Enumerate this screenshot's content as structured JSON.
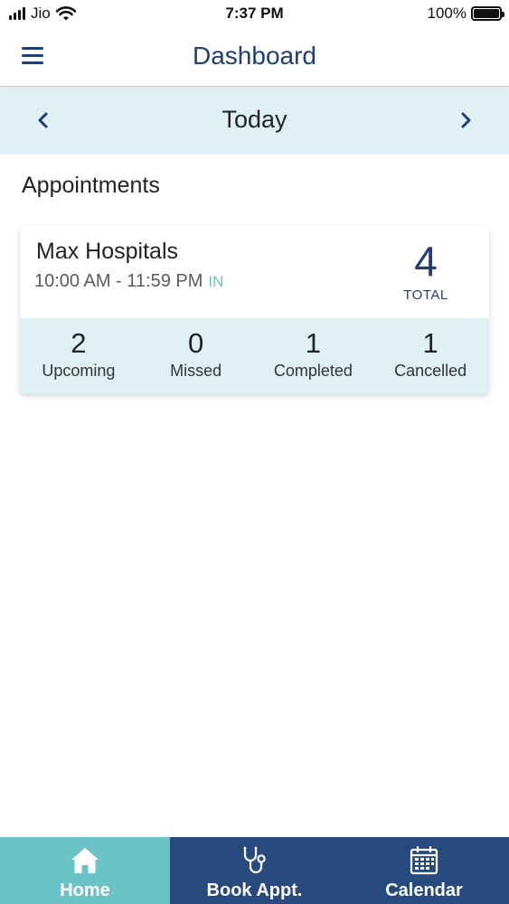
{
  "status_bar": {
    "carrier": "Jio",
    "time": "7:37 PM",
    "battery": "100%"
  },
  "header": {
    "title": "Dashboard",
    "menu_icon": "hamburger-menu-icon"
  },
  "date_nav": {
    "label": "Today",
    "prev_icon": "chevron-left-icon",
    "next_icon": "chevron-right-icon"
  },
  "section": {
    "title": "Appointments"
  },
  "card": {
    "hospital": "Max Hospitals",
    "time_range": "10:00 AM - 11:59 PM",
    "status": "IN",
    "total": "4",
    "total_label": "TOTAL",
    "stats": [
      {
        "value": "2",
        "label": "Upcoming"
      },
      {
        "value": "0",
        "label": "Missed"
      },
      {
        "value": "1",
        "label": "Completed"
      },
      {
        "value": "1",
        "label": "Cancelled"
      }
    ]
  },
  "tab_bar": {
    "tabs": [
      {
        "label": "Home",
        "icon": "home-icon",
        "active": true
      },
      {
        "label": "Book Appt.",
        "icon": "stethoscope-icon",
        "active": false
      },
      {
        "label": "Calendar",
        "icon": "calendar-icon",
        "active": false
      }
    ]
  },
  "colors": {
    "primary": "#1f3e75",
    "accent": "#6bc2c7",
    "tab_bar": "#294a7c",
    "light_band": "#dff0f3",
    "status_in": "#6cc3c0"
  }
}
